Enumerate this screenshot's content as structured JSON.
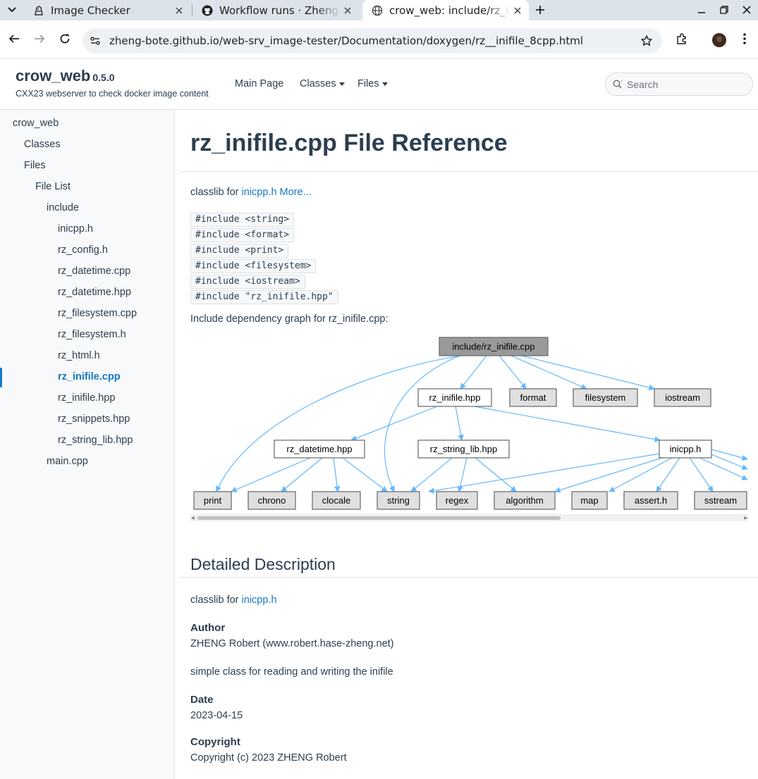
{
  "browser": {
    "tabs": [
      {
        "title": "Image Checker",
        "icon": "dragon-icon"
      },
      {
        "title": "Workflow runs · Zheng-Bote/web-srv_image-tester",
        "icon": "github-icon"
      },
      {
        "title": "crow_web: include/rz_inifile.cpp File Reference",
        "icon": "globe-icon",
        "active": true
      }
    ],
    "url": "zheng-bote.github.io/web-srv_image-tester/Documentation/doxygen/rz__inifile_8cpp.html"
  },
  "header": {
    "project_name": "crow_web",
    "project_version": "0.5.0",
    "project_brief": "CXX23 webserver to check docker image content",
    "menu": {
      "main_page": "Main Page",
      "classes": "Classes",
      "files": "Files"
    },
    "search_placeholder": "Search"
  },
  "sidebar": {
    "items": [
      {
        "label": "crow_web",
        "level": 0
      },
      {
        "label": "Classes",
        "level": 1
      },
      {
        "label": "Files",
        "level": 1
      },
      {
        "label": "File List",
        "level": 2
      },
      {
        "label": "include",
        "level": 3
      },
      {
        "label": "inicpp.h",
        "level": 4
      },
      {
        "label": "rz_config.h",
        "level": 4
      },
      {
        "label": "rz_datetime.cpp",
        "level": 4
      },
      {
        "label": "rz_datetime.hpp",
        "level": 4
      },
      {
        "label": "rz_filesystem.cpp",
        "level": 4
      },
      {
        "label": "rz_filesystem.h",
        "level": 4
      },
      {
        "label": "rz_html.h",
        "level": 4
      },
      {
        "label": "rz_inifile.cpp",
        "level": 4,
        "selected": true
      },
      {
        "label": "rz_inifile.hpp",
        "level": 4
      },
      {
        "label": "rz_snippets.hpp",
        "level": 4
      },
      {
        "label": "rz_string_lib.hpp",
        "level": 4
      },
      {
        "label": "main.cpp",
        "level": 3
      }
    ]
  },
  "main": {
    "title": "rz_inifile.cpp File Reference",
    "brief_prefix": "classlib for",
    "brief_link": "inicpp.h",
    "more_link": "More...",
    "includes": [
      "#include <string>",
      "#include <format>",
      "#include <print>",
      "#include <filesystem>",
      "#include <iostream>",
      "#include \"rz_inifile.hpp\""
    ],
    "graph_caption": "Include dependency graph for rz_inifile.cpp:",
    "graph": {
      "nodes": [
        {
          "id": "root",
          "label": "include/rz_inifile.cpp"
        },
        {
          "id": "rzinihpp",
          "label": "rz_inifile.hpp"
        },
        {
          "id": "format",
          "label": "format"
        },
        {
          "id": "filesystem",
          "label": "filesystem"
        },
        {
          "id": "iostream",
          "label": "iostream"
        },
        {
          "id": "rzdatetime",
          "label": "rz_datetime.hpp"
        },
        {
          "id": "rzstrlib",
          "label": "rz_string_lib.hpp"
        },
        {
          "id": "inicpp",
          "label": "inicpp.h"
        },
        {
          "id": "print",
          "label": "print"
        },
        {
          "id": "chrono",
          "label": "chrono"
        },
        {
          "id": "clocale",
          "label": "clocale"
        },
        {
          "id": "string",
          "label": "string"
        },
        {
          "id": "regex",
          "label": "regex"
        },
        {
          "id": "algorithm",
          "label": "algorithm"
        },
        {
          "id": "map",
          "label": "map"
        },
        {
          "id": "asserth",
          "label": "assert.h"
        },
        {
          "id": "sstream",
          "label": "sstream"
        }
      ],
      "colors": {
        "edge": "#63b8ff",
        "root_fill": "#999999",
        "header_fill": "#ffffff",
        "system_fill": "#e0e0e0",
        "border": "#666666"
      }
    },
    "detailed": {
      "heading": "Detailed Description",
      "brief_prefix": "classlib for",
      "brief_link": "inicpp.h",
      "author_label": "Author",
      "author_value": "ZHENG Robert (www.robert.hase-zheng.net)",
      "description": "simple class for reading and writing the inifile",
      "date_label": "Date",
      "date_value": "2023-04-15",
      "copyright_label": "Copyright",
      "copyright_value": "Copyright (c) 2023 ZHENG Robert"
    }
  }
}
